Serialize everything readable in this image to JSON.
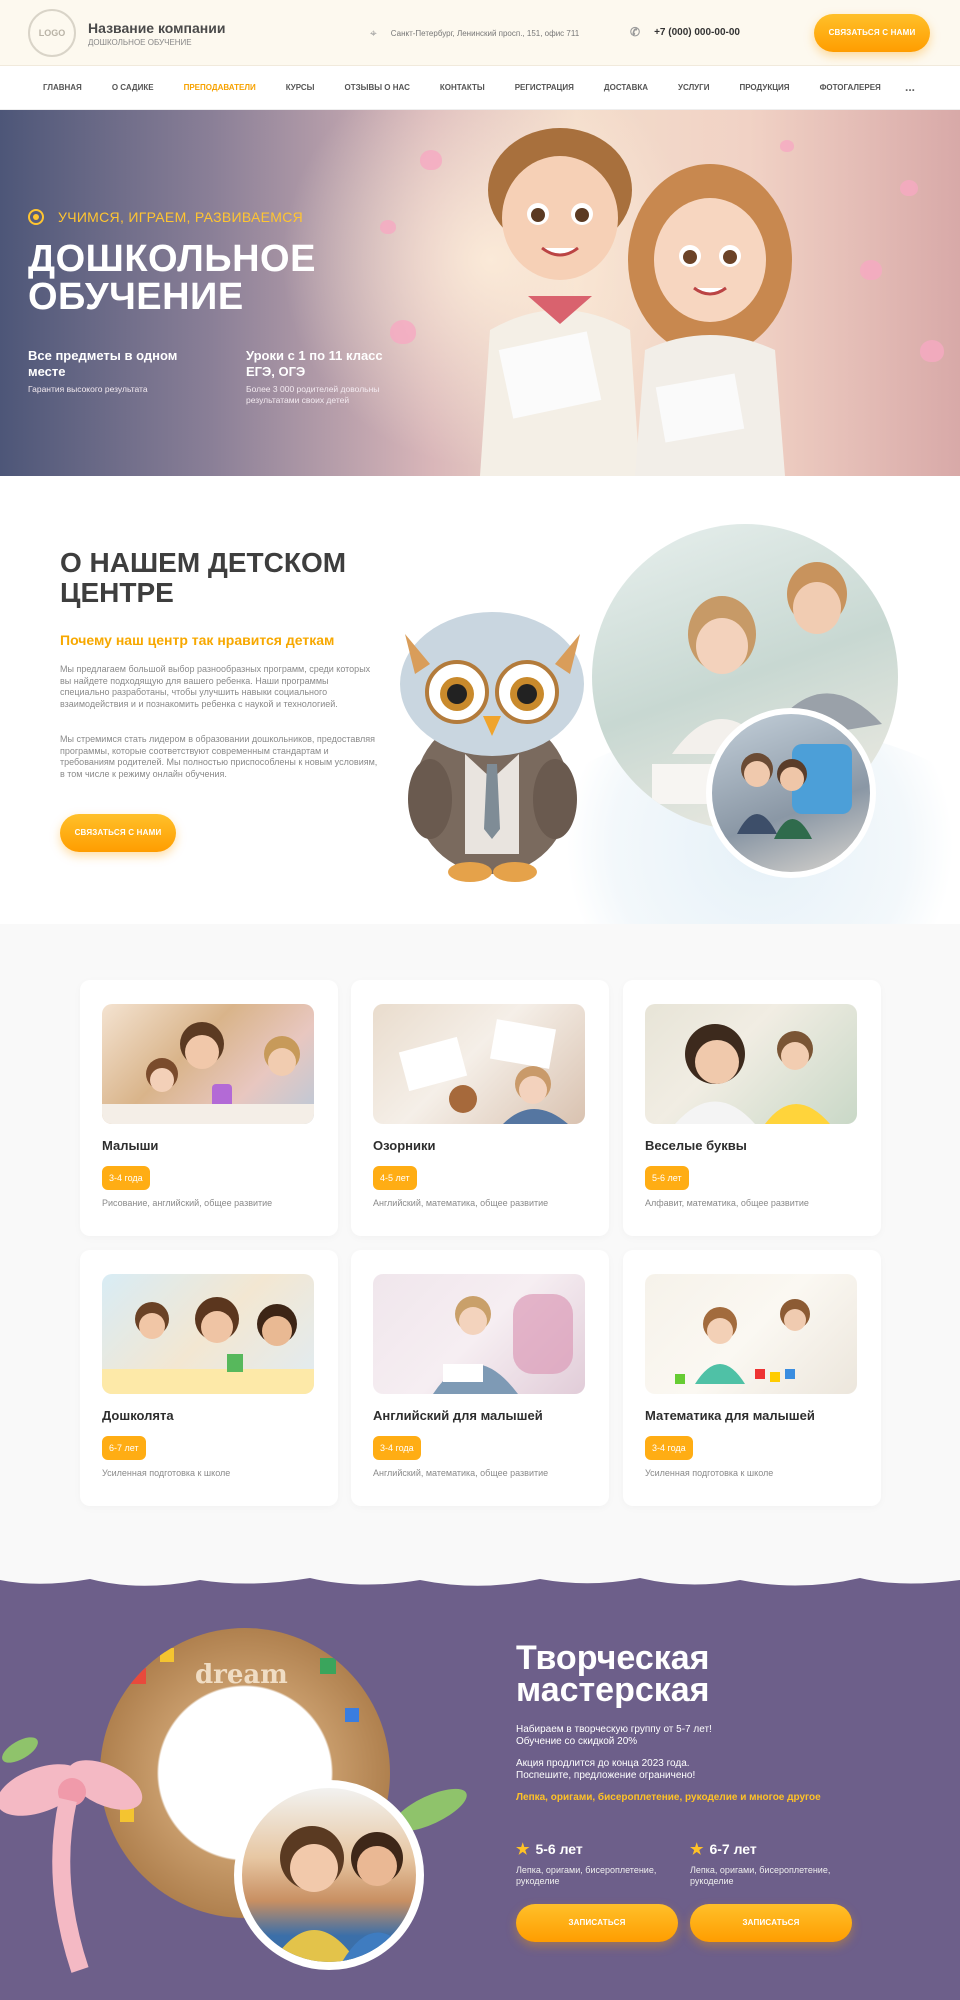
{
  "header": {
    "logo_text": "LOGO",
    "company_name": "Название компании",
    "company_sub": "ДОШКОЛЬНОЕ ОБУЧЕНИЕ",
    "address": "Санкт-Петербург, Ленинский просп., 151, офис 711",
    "phone": "+7 (000) 000-00-00",
    "cta": "СВЯЗАТЬСЯ С НАМИ"
  },
  "nav": {
    "items": [
      "ГЛАВНАЯ",
      "О САДИКЕ",
      "ПРЕПОДАВАТЕЛИ",
      "КУРСЫ",
      "ОТЗЫВЫ О НАС",
      "КОНТАКТЫ",
      "РЕГИСТРАЦИЯ",
      "ДОСТАВКА",
      "УСЛУГИ",
      "ПРОДУКЦИЯ",
      "ФОТОГАЛЕРЕЯ"
    ],
    "active_index": 2,
    "more": "..."
  },
  "hero": {
    "tagline": "УЧИМСЯ, ИГРАЕМ, РАЗВИВАЕМСЯ",
    "title": "ДОШКОЛЬНОЕ ОБУЧЕНИЕ",
    "feature1_title": "Все предметы в одном месте",
    "feature1_sub": "Гарантия высокого результата",
    "feature2_title": "Уроки с 1 по 11 класс ЕГЭ, ОГЭ",
    "feature2_sub": "Более 3 000 родителей довольны результатами своих детей"
  },
  "about": {
    "title": "О НАШЕМ ДЕТСКОМ ЦЕНТРЕ",
    "subtitle": "Почему наш центр так нравится деткам",
    "p1": "Мы предлагаем большой выбор разнообразных программ, среди которых вы найдете подходящую для вашего ребенка. Наши программы специально разработаны, чтобы улучшить навыки социального взаимодействия и и познакомить ребенка с наукой и технологией.",
    "p2": "Мы стремимся стать лидером в образовании дошкольников, предоставляя программы, которые соответствуют современным стандартам и требованиям родителей. Мы полностью приспособлены к новым условиям, в том числе к режиму онлайн обучения.",
    "cta": "СВЯЗАТЬСЯ С НАМИ"
  },
  "courses": [
    {
      "title": "Малыши",
      "age": "3-4 года",
      "desc": "Рисование, английский, общее развитие"
    },
    {
      "title": "Озорники",
      "age": "4-5 лет",
      "desc": "Английский, математика, общее развитие"
    },
    {
      "title": "Веселые буквы",
      "age": "5-6 лет",
      "desc": "Алфавит, математика, общее развитие"
    },
    {
      "title": "Дошколята",
      "age": "6-7 лет",
      "desc": "Усиленная подготовка к школе"
    },
    {
      "title": "Английский для малышей",
      "age": "3-4 года",
      "desc": "Английский, математика, общее развитие"
    },
    {
      "title": "Математика для малышей",
      "age": "3-4 года",
      "desc": "Усиленная подготовка к школе"
    }
  ],
  "workshop": {
    "title": "Творческая мастерская",
    "line1": "Набираем в творческую группу от 5-7 лет!",
    "line2": "Обучение со скидкой 20%",
    "line3": "Акция продлится до конца 2023 года.",
    "line4": "Поспешите, предложение ограничено!",
    "accent": "Лепка, оригами, бисероплетение, рукоделие и многое другое",
    "group1_title": "5-6 лет",
    "group1_desc": "Лепка, оригами, бисероплетение, рукоделие",
    "group2_title": "6-7 лет",
    "group2_desc": "Лепка, оригами, бисероплетение, рукоделие",
    "enroll": "ЗАПИСАТЬСЯ",
    "dream_text": "dream"
  },
  "colors": {
    "accent": "#ffa500",
    "purple": "#6d5f8a",
    "text": "#333333"
  }
}
